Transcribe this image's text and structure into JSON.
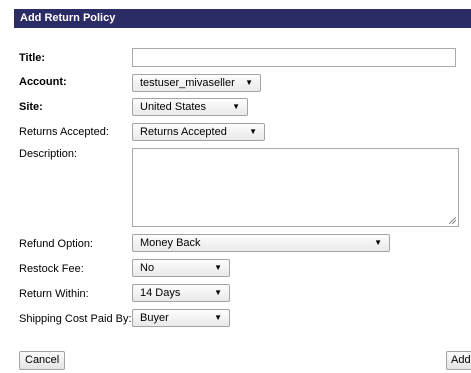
{
  "header": {
    "title": "Add Return Policy"
  },
  "form": {
    "title": {
      "label": "Title:",
      "value": ""
    },
    "account": {
      "label": "Account:",
      "selected": "testuser_mivaseller"
    },
    "site": {
      "label": "Site:",
      "selected": "United States"
    },
    "returns_accepted": {
      "label": "Returns Accepted:",
      "selected": "Returns Accepted"
    },
    "description": {
      "label": "Description:",
      "value": ""
    },
    "refund_option": {
      "label": "Refund Option:",
      "selected": "Money Back"
    },
    "restock_fee": {
      "label": "Restock Fee:",
      "selected": "No"
    },
    "return_within": {
      "label": "Return Within:",
      "selected": "14 Days"
    },
    "shipping_cost_paid_by": {
      "label": "Shipping Cost Paid By:",
      "selected": "Buyer"
    }
  },
  "dropdown_arrow": "▼",
  "buttons": {
    "cancel": "Cancel",
    "add": "Add"
  },
  "colors": {
    "header_bg": "#2b2b66",
    "header_text": "#ffffff"
  }
}
